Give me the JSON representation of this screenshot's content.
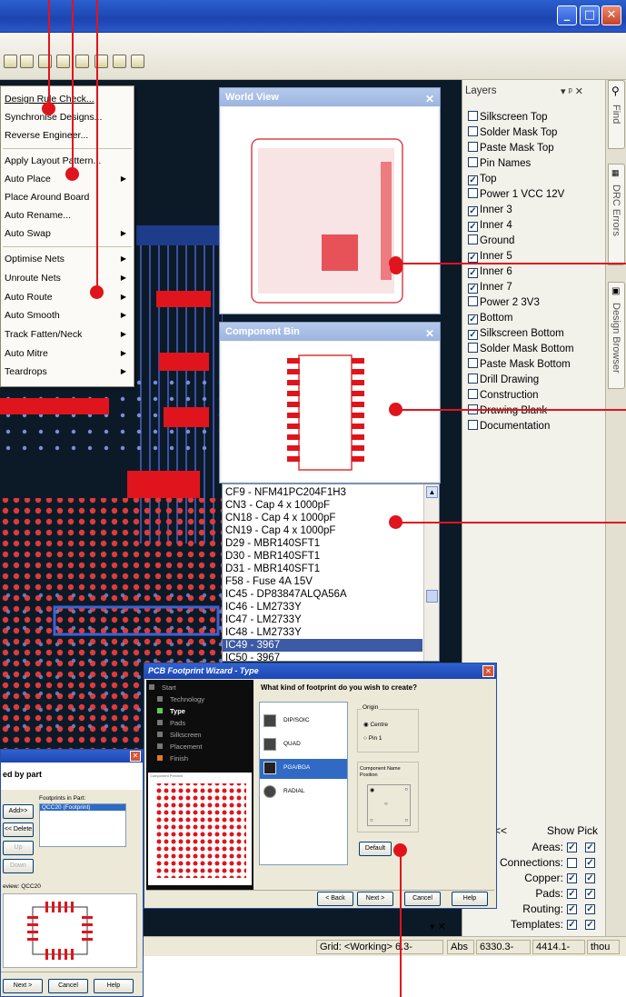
{
  "menu": {
    "items": [
      {
        "label": "Design Rule Check...",
        "submenu": false
      },
      {
        "label": "Synchronise Designs...",
        "submenu": false
      },
      {
        "label": "Reverse Engineer...",
        "submenu": false
      },
      {
        "label": "Apply Layout Pattern...",
        "submenu": false
      },
      {
        "label": "Auto Place",
        "submenu": true
      },
      {
        "label": "Place Around Board",
        "submenu": false
      },
      {
        "label": "Auto Rename...",
        "submenu": false
      },
      {
        "label": "Auto Swap",
        "submenu": true
      },
      {
        "label": "Optimise Nets",
        "submenu": true
      },
      {
        "label": "Unroute Nets",
        "submenu": true
      },
      {
        "label": "Auto Route",
        "submenu": true
      },
      {
        "label": "Auto Smooth",
        "submenu": true
      },
      {
        "label": "Track Fatten/Neck",
        "submenu": true
      },
      {
        "label": "Auto Mitre",
        "submenu": true
      },
      {
        "label": "Teardrops",
        "submenu": true
      }
    ]
  },
  "world_view": {
    "title": "World View"
  },
  "component_bin": {
    "title": "Component Bin",
    "components": [
      {
        "label": "CF9 - NFM41PC204F1H3",
        "selected": false
      },
      {
        "label": "CN3 - Cap 4 x 1000pF",
        "selected": false
      },
      {
        "label": "CN18 - Cap 4 x 1000pF",
        "selected": false
      },
      {
        "label": "CN19 - Cap 4 x 1000pF",
        "selected": false
      },
      {
        "label": "D29 - MBR140SFT1",
        "selected": false
      },
      {
        "label": "D30 - MBR140SFT1",
        "selected": false
      },
      {
        "label": "D31 - MBR140SFT1",
        "selected": false
      },
      {
        "label": "F58 - Fuse 4A 15V",
        "selected": false
      },
      {
        "label": "IC45 - DP83847ALQA56A",
        "selected": false
      },
      {
        "label": "IC46 - LM2733Y",
        "selected": false
      },
      {
        "label": "IC47 - LM2733Y",
        "selected": false
      },
      {
        "label": "IC48 - LM2733Y",
        "selected": false
      },
      {
        "label": "IC49 - 3967",
        "selected": true
      },
      {
        "label": "IC50 - 3967",
        "selected": false
      }
    ]
  },
  "layers": {
    "title": "Layers",
    "pin": "▾ ᵖ ✕",
    "items": [
      {
        "name": "Silkscreen Top",
        "checked": false
      },
      {
        "name": "Solder Mask Top",
        "checked": false
      },
      {
        "name": "Paste Mask Top",
        "checked": false
      },
      {
        "name": "Pin Names",
        "checked": false
      },
      {
        "name": "Top",
        "checked": true
      },
      {
        "name": "Power 1 VCC 12V",
        "checked": false
      },
      {
        "name": "Inner 3",
        "checked": true
      },
      {
        "name": "Inner 4",
        "checked": true
      },
      {
        "name": "Ground",
        "checked": false
      },
      {
        "name": "Inner 5",
        "checked": true
      },
      {
        "name": "Inner 6",
        "checked": true
      },
      {
        "name": "Inner 7",
        "checked": true
      },
      {
        "name": "Power 2 3V3",
        "checked": false
      },
      {
        "name": "Bottom",
        "checked": true
      },
      {
        "name": "Silkscreen Bottom",
        "checked": true
      },
      {
        "name": "Solder Mask Bottom",
        "checked": false
      },
      {
        "name": "Paste Mask Bottom",
        "checked": false
      },
      {
        "name": "Drill Drawing",
        "checked": false
      },
      {
        "name": "Construction",
        "checked": false
      },
      {
        "name": "Drawing Blank",
        "checked": false
      },
      {
        "name": "Documentation",
        "checked": false
      }
    ]
  },
  "side_tabs": {
    "find": "Find",
    "drc": "DRC Errors",
    "design_browser": "Design Browser"
  },
  "show_pick": {
    "collapse": "<<",
    "header": "Show Pick",
    "rows": [
      {
        "label": "Areas:",
        "show": true,
        "pick": true
      },
      {
        "label": "Connections:",
        "show": false,
        "pick": true
      },
      {
        "label": "Copper:",
        "show": true,
        "pick": true
      },
      {
        "label": "Pads:",
        "show": true,
        "pick": true
      },
      {
        "label": "Routing:",
        "show": true,
        "pick": true
      },
      {
        "label": "Templates:",
        "show": true,
        "pick": true
      }
    ]
  },
  "status": {
    "pin_close": "▾ ✕",
    "grid": "Grid: <Working> 6.3-",
    "abs_label": "Abs",
    "x": "6330.3-",
    "y": "4414.1-",
    "units": "thou"
  },
  "wizard": {
    "title": "PCB Footprint Wizard - Type",
    "steps": [
      "Start",
      "Technology",
      "Type",
      "Pads",
      "Silkscreen",
      "Placement",
      "Finish"
    ],
    "active_step": "Type",
    "question": "What kind of footprint do you wish to create?",
    "types": [
      "DIP/SOIC",
      "QUAD",
      "PGA/BGA",
      "RADIAL"
    ],
    "selected_type": "PGA/BGA",
    "origin": {
      "legend": "Origin",
      "options": [
        "Centre",
        "Pin 1"
      ],
      "selected": "Centre"
    },
    "name_position": {
      "legend": "Component Name Position"
    },
    "preview_label": "Component Preview",
    "default_button": "Default",
    "back_button": "< Back",
    "next_button": "Next >",
    "cancel_button": "Cancel",
    "help_button": "Help"
  },
  "part_dialog": {
    "title_fragment": "ed by part",
    "footprints_label": "Footprints in Part:",
    "footprint_selected": "QCC20 (Footprint)",
    "add_button": "Add>>",
    "delete_button": "<< Delete",
    "up_button": "Up",
    "down_button": "Down",
    "preview_label": "eview: QCC20",
    "next_button": "Next >",
    "cancel_button": "Cancel",
    "help_button": "Help"
  },
  "colors": {
    "accent_red": "#e0141c",
    "titlebar_blue": "#2458c6",
    "pcb_background": "#0c1a28"
  }
}
